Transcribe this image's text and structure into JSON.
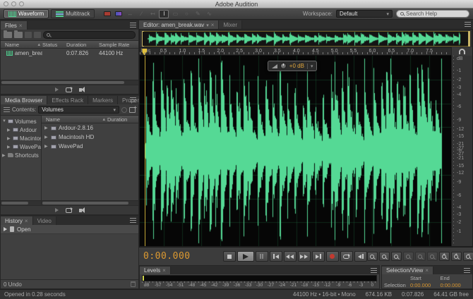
{
  "window": {
    "title": "Adobe Audition"
  },
  "appbar": {
    "view_tabs": [
      {
        "label": "Waveform"
      },
      {
        "label": "Multitrack"
      }
    ],
    "workspace_label": "Workspace:",
    "workspace_value": "Default",
    "search_placeholder": "Search Help"
  },
  "files_panel": {
    "tab_label": "Files",
    "columns": {
      "name": "Name",
      "status": "Status",
      "duration": "Duration",
      "sample_rate": "Sample Rate"
    },
    "rows": [
      {
        "name": "amen_break.wav",
        "duration": "0:07.826",
        "sample_rate": "44100 Hz"
      }
    ]
  },
  "media_browser": {
    "tabs": [
      {
        "label": "Media Browser"
      },
      {
        "label": "Effects Rack"
      },
      {
        "label": "Markers"
      },
      {
        "label": "Properties"
      }
    ],
    "contents_label": "Contents:",
    "contents_value": "Volumes",
    "tree": [
      {
        "label": "Volumes"
      },
      {
        "label": "Ardour"
      },
      {
        "label": "Macintosh"
      },
      {
        "label": "WavePad"
      },
      {
        "label": "Shortcuts"
      }
    ],
    "list_columns": {
      "name": "Name",
      "duration": "Duration"
    },
    "rows": [
      {
        "name": "Ardour-2.8.16"
      },
      {
        "name": "Macintosh HD"
      },
      {
        "name": "WavePad"
      }
    ]
  },
  "history_panel": {
    "tabs": [
      {
        "label": "History"
      },
      {
        "label": "Video"
      }
    ],
    "items": [
      {
        "label": "Open"
      }
    ],
    "undo_label": "0 Undo"
  },
  "editor": {
    "tab_label": "Editor: amen_break.wav",
    "mixer_tab_label": "Mixer",
    "ruler_unit": "hms",
    "time_labels": [
      "0.5",
      "1.0",
      "1.5",
      "2.0",
      "2.5",
      "3.0",
      "3.5",
      "4.0",
      "4.5",
      "5.0",
      "5.5",
      "6.0",
      "6.5",
      "7.0",
      "7.5"
    ],
    "db_scale": [
      "dB",
      "-1",
      "-2",
      "-3",
      "-4",
      "-6",
      "-9",
      "-12",
      "-15",
      "-21",
      "-27",
      "-∞",
      "-27",
      "-21",
      "-15",
      "-12",
      "-9",
      "-6",
      "-4",
      "-3",
      "-2",
      "-1"
    ],
    "hud_gain": "+0 dB",
    "waveform_color": "#55d995",
    "duration_seconds": 7.826
  },
  "transport": {
    "time_display": "0:00.000",
    "buttons": [
      "stop",
      "play",
      "pause",
      "skip-to-start",
      "rewind",
      "fast-forward",
      "skip-to-end",
      "record",
      "loop",
      "skip-selection"
    ],
    "zoom_buttons": [
      "zoom-in-point",
      "zoom-out-point",
      "zoom-selection",
      "zoom-in-amplitude",
      "zoom-out-amplitude",
      "zoom-reset",
      "zoom-in",
      "zoom-out",
      "zoom-full"
    ]
  },
  "levels_panel": {
    "tab_label": "Levels",
    "scale": [
      "dB",
      "-57",
      "-54",
      "-51",
      "-48",
      "-45",
      "-42",
      "-39",
      "-36",
      "-33",
      "-30",
      "-27",
      "-24",
      "-21",
      "-18",
      "-15",
      "-12",
      "-9",
      "-6",
      "-3",
      "0"
    ]
  },
  "selection_panel": {
    "tab_label": "Selection/View",
    "columns": {
      "start": "Start",
      "end": "End"
    },
    "row_label": "Selection",
    "start_value": "0:00.000",
    "end_value": "0:00.000"
  },
  "status_bar": {
    "left_text": "Opened in 0.28 seconds",
    "format_text": "44100 Hz • 16-bit • Mono",
    "file_size": "674.16 KB",
    "duration": "0:07.826",
    "free_space": "64.41 GB free"
  }
}
